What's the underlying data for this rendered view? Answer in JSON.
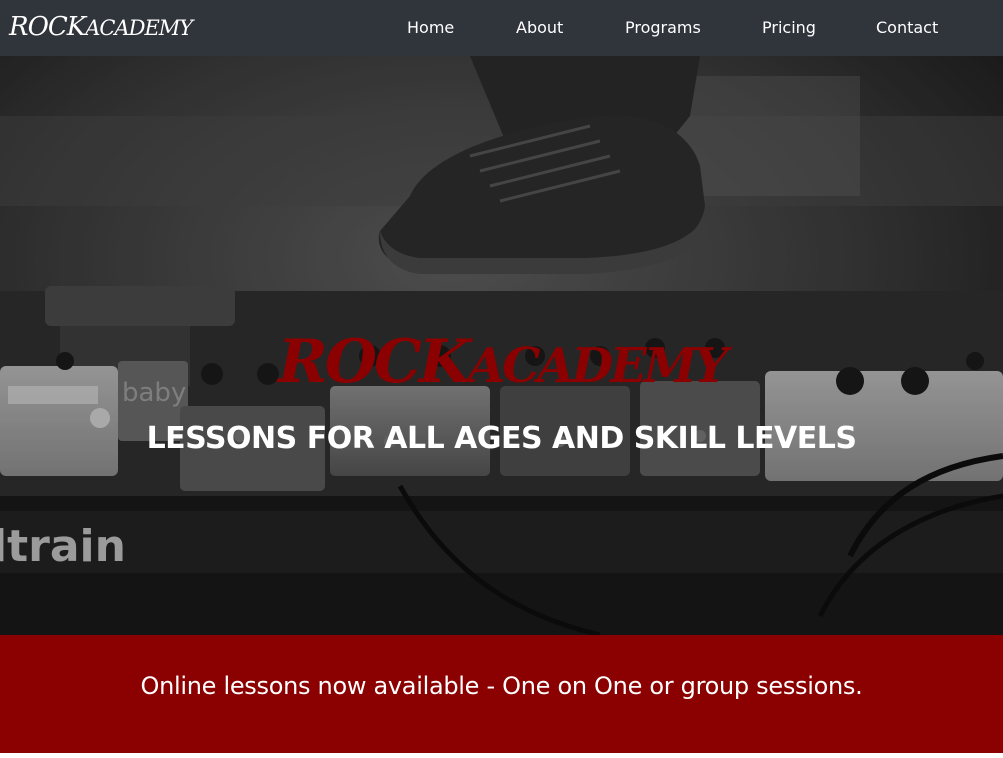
{
  "nav": {
    "brand_first": "Rock",
    "brand_second": "Academy",
    "links": [
      "Home",
      "About",
      "Programs",
      "Pricing",
      "Contact"
    ]
  },
  "hero": {
    "logo_first": "Rock",
    "logo_second": "Academy",
    "tagline": "LESSONS FOR ALL AGES AND SKILL LEVELS",
    "background_image": "black-and-white photo of a sneaker stepping on guitar effect pedals",
    "pedal_brand_text": "ltrain",
    "pedal_label_text": "baby"
  },
  "banner": {
    "text": "Online lessons now available - One on One or group sessions."
  },
  "colors": {
    "navbar": "#30343b",
    "accent": "#8b0000",
    "text_light": "#ffffff"
  }
}
